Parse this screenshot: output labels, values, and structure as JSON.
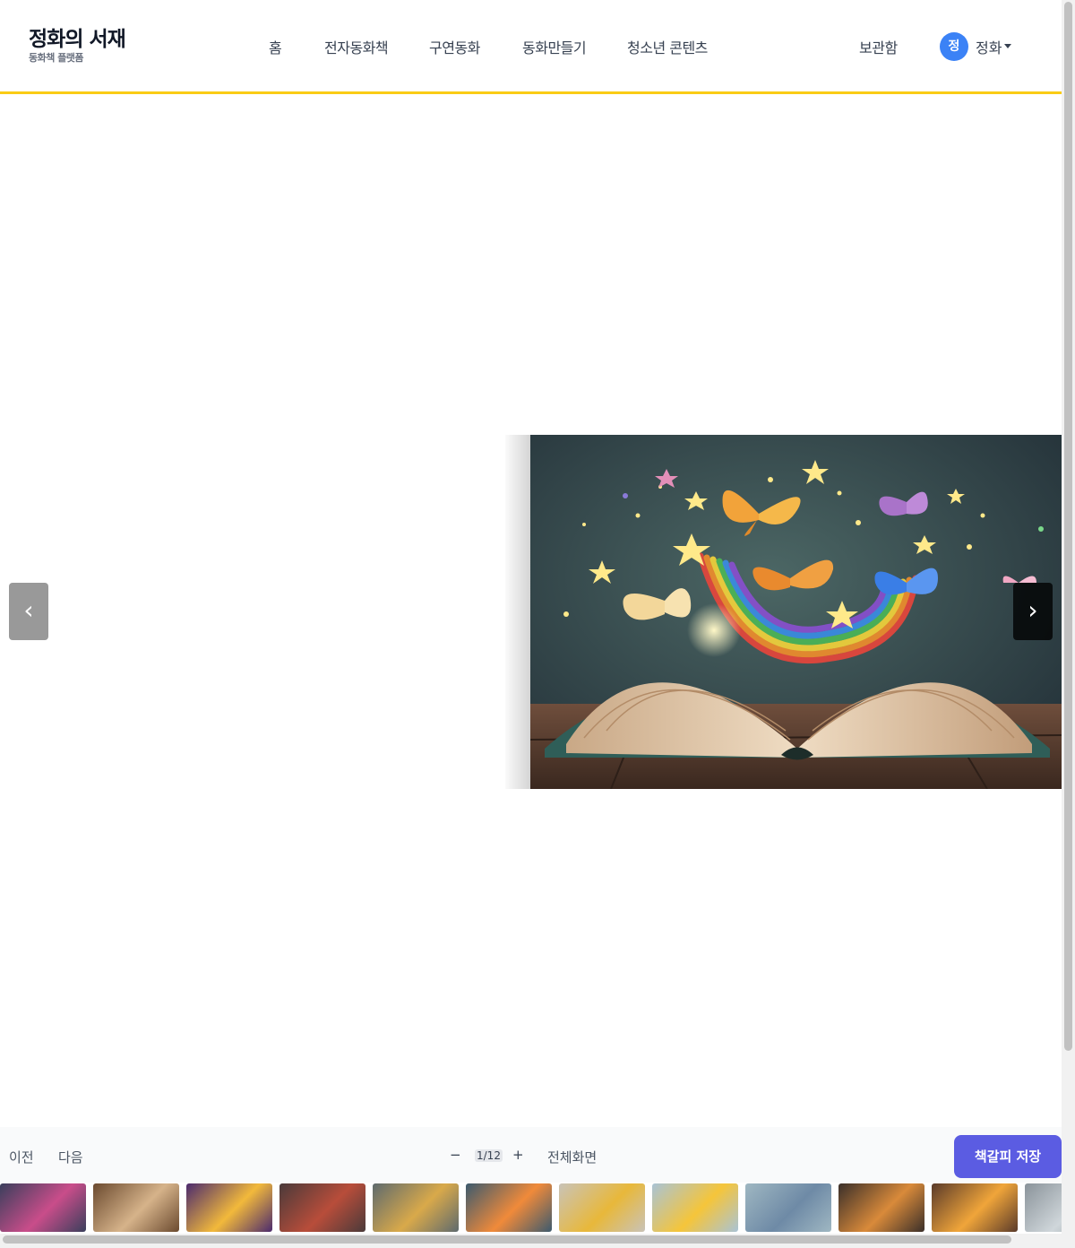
{
  "brand": {
    "title": "정화의 서재",
    "subtitle": "동화책 플랫폼"
  },
  "nav": [
    {
      "label": "홈"
    },
    {
      "label": "전자동화책"
    },
    {
      "label": "구연동화"
    },
    {
      "label": "동화만들기"
    },
    {
      "label": "청소년 콘텐츠"
    }
  ],
  "header_right": {
    "archive_label": "보관함",
    "avatar_initial": "정",
    "user_name": "정화"
  },
  "viewer": {
    "prev_arrow": "‹",
    "next_arrow": "›",
    "page_image": "open-book-rainbow-butterflies-stars"
  },
  "toolbar": {
    "prev_label": "이전",
    "next_label": "다음",
    "zoom_out": "−",
    "page_counter": "1/12",
    "zoom_in": "+",
    "fullscreen_label": "전체화면",
    "bookmark_label": "책갈피 저장"
  },
  "thumbnails": [
    {
      "image": "glowing-book-butterflies",
      "colors": [
        "#3a3f5c",
        "#c94d8a"
      ]
    },
    {
      "image": "open-book-pages",
      "colors": [
        "#6b4a2f",
        "#d6b38a"
      ]
    },
    {
      "image": "rainbow-book",
      "colors": [
        "#4b2a6e",
        "#f2b93b"
      ]
    },
    {
      "image": "book-stack",
      "colors": [
        "#4a3a3a",
        "#b84d3a"
      ]
    },
    {
      "image": "golden-heart-books",
      "colors": [
        "#5e6a6e",
        "#d9a94a"
      ]
    },
    {
      "image": "cartoon-ball-rainbow",
      "colors": [
        "#3c5a6e",
        "#f08a3a"
      ]
    },
    {
      "image": "character-on-books",
      "colors": [
        "#c9c3b8",
        "#e8b83a"
      ]
    },
    {
      "image": "smiling-pencil-character",
      "colors": [
        "#a9c3d6",
        "#f5c53a"
      ]
    },
    {
      "image": "girl-reading",
      "colors": [
        "#9fb7c2",
        "#6e8aa6"
      ]
    },
    {
      "image": "woman-writing",
      "colors": [
        "#3a2f2a",
        "#d98a3a"
      ]
    },
    {
      "image": "teacher-portrait",
      "colors": [
        "#5a3a2a",
        "#f0a53a"
      ]
    },
    {
      "image": "person-partial",
      "colors": [
        "#8a939a",
        "#cfd6da"
      ]
    }
  ]
}
